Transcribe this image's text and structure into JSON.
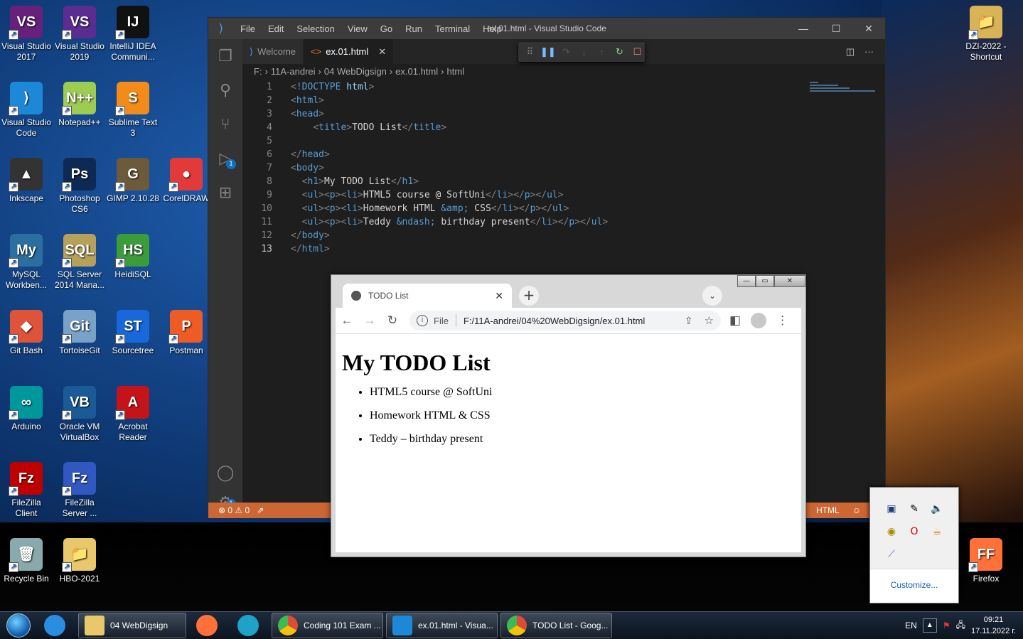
{
  "desktop": {
    "icons": [
      {
        "label": "Visual Studio 2017",
        "glyph": "VS",
        "color": "#68217a"
      },
      {
        "label": "Visual Studio 2019",
        "glyph": "VS",
        "color": "#5c2d91"
      },
      {
        "label": "IntelliJ IDEA Communi...",
        "glyph": "IJ",
        "color": "#111"
      },
      {
        "label": "Visual Studio Code",
        "glyph": "⟩",
        "color": "#1e88d8"
      },
      {
        "label": "Notepad++",
        "glyph": "N++",
        "color": "#9ccc52"
      },
      {
        "label": "Sublime Text 3",
        "glyph": "S",
        "color": "#f38b1a"
      },
      {
        "label": "Inkscape",
        "glyph": "▲",
        "color": "#333"
      },
      {
        "label": "Photoshop CS6",
        "glyph": "Ps",
        "color": "#0e2a53"
      },
      {
        "label": "GIMP 2.10.28",
        "glyph": "G",
        "color": "#6d5a3a"
      },
      {
        "label": "CorelDRAW",
        "glyph": "●",
        "color": "#e23a3a"
      },
      {
        "label": "MySQL Workben...",
        "glyph": "My",
        "color": "#2b6ea0"
      },
      {
        "label": "SQL Server 2014 Mana...",
        "glyph": "SQL",
        "color": "#b5a15a"
      },
      {
        "label": "HeidiSQL",
        "glyph": "HS",
        "color": "#3c9c3c"
      },
      {
        "label": "Git Bash",
        "glyph": "◆",
        "color": "#e0533b"
      },
      {
        "label": "TortoiseGit",
        "glyph": "Git",
        "color": "#7aa2c8"
      },
      {
        "label": "Sourcetree",
        "glyph": "ST",
        "color": "#1868db"
      },
      {
        "label": "Postman",
        "glyph": "P",
        "color": "#ef5b25"
      },
      {
        "label": "Arduino",
        "glyph": "∞",
        "color": "#00979c"
      },
      {
        "label": "Oracle VM VirtualBox",
        "glyph": "VB",
        "color": "#1a5a96"
      },
      {
        "label": "Acrobat Reader",
        "glyph": "A",
        "color": "#c4141a"
      },
      {
        "label": "FileZilla Client",
        "glyph": "Fz",
        "color": "#bf0000"
      },
      {
        "label": "FileZilla Server ...",
        "glyph": "Fz",
        "color": "#3058c0"
      },
      {
        "label": "Recycle Bin",
        "glyph": "🗑",
        "color": "#8aa"
      },
      {
        "label": "HBO-2021",
        "glyph": "📁",
        "color": "#e8c86a"
      },
      {
        "label": "DZI-2022 - Shortcut",
        "glyph": "📁",
        "color": "#d9b355"
      },
      {
        "label": "Firefox",
        "glyph": "FF",
        "color": "#ff7139"
      }
    ]
  },
  "vscode": {
    "menu": [
      "File",
      "Edit",
      "Selection",
      "View",
      "Go",
      "Run",
      "Terminal",
      "Help"
    ],
    "window_title": "ex.01.html - Visual Studio Code",
    "tabs": [
      {
        "label": "Welcome"
      },
      {
        "label": "ex.01.html"
      }
    ],
    "breadcrumb": [
      "F:",
      "11A-andrei",
      "04 WebDigsign",
      "ex.01.html",
      "html"
    ],
    "activity_badges": [
      "1",
      "1"
    ],
    "status": {
      "errors": "0",
      "warnings": "0",
      "language": "HTML"
    }
  },
  "code_lines": [
    {
      "n": "1",
      "html": "<span class='br'>&lt;</span><span class='tag'>!DOCTYPE</span> <span class='tag' style='color:#9cdcfe'>html</span><span class='br'>&gt;</span>"
    },
    {
      "n": "2",
      "html": "<span class='br'>&lt;</span><span class='tag'>html</span><span class='br'>&gt;</span>"
    },
    {
      "n": "3",
      "html": "<span class='br'>&lt;</span><span class='tag'>head</span><span class='br'>&gt;</span>"
    },
    {
      "n": "4",
      "html": "    <span class='br'>&lt;</span><span class='tag'>title</span><span class='br'>&gt;</span>TODO List<span class='br'>&lt;/</span><span class='tag'>title</span><span class='br'>&gt;</span>"
    },
    {
      "n": "5",
      "html": ""
    },
    {
      "n": "6",
      "html": "<span class='br'>&lt;/</span><span class='tag'>head</span><span class='br'>&gt;</span>"
    },
    {
      "n": "7",
      "html": "<span class='br'>&lt;</span><span class='tag'>body</span><span class='br'>&gt;</span>"
    },
    {
      "n": "8",
      "html": "  <span class='br'>&lt;</span><span class='tag'>h1</span><span class='br'>&gt;</span>My TODO List<span class='br'>&lt;/</span><span class='tag'>h1</span><span class='br'>&gt;</span>"
    },
    {
      "n": "9",
      "html": "  <span class='br'>&lt;</span><span class='tag'>ul</span><span class='br'>&gt;&lt;</span><span class='tag'>p</span><span class='br'>&gt;&lt;</span><span class='tag'>li</span><span class='br'>&gt;</span>HTML5 course @ SoftUni<span class='br'>&lt;/</span><span class='tag'>li</span><span class='br'>&gt;&lt;/</span><span class='tag'>p</span><span class='br'>&gt;&lt;/</span><span class='tag'>ul</span><span class='br'>&gt;</span>"
    },
    {
      "n": "10",
      "html": "  <span class='br'>&lt;</span><span class='tag'>ul</span><span class='br'>&gt;&lt;</span><span class='tag'>p</span><span class='br'>&gt;&lt;</span><span class='tag'>li</span><span class='br'>&gt;</span>Homework HTML <span class='ent'>&amp;amp;</span> CSS<span class='br'>&lt;/</span><span class='tag'>li</span><span class='br'>&gt;&lt;/</span><span class='tag'>p</span><span class='br'>&gt;&lt;/</span><span class='tag'>ul</span><span class='br'>&gt;</span>"
    },
    {
      "n": "11",
      "html": "  <span class='br'>&lt;</span><span class='tag'>ul</span><span class='br'>&gt;&lt;</span><span class='tag'>p</span><span class='br'>&gt;&lt;</span><span class='tag'>li</span><span class='br'>&gt;</span>Teddy <span class='ent'>&amp;ndash;</span> birthday present<span class='br'>&lt;/</span><span class='tag'>li</span><span class='br'>&gt;&lt;/</span><span class='tag'>p</span><span class='br'>&gt;&lt;/</span><span class='tag'>ul</span><span class='br'>&gt;</span>"
    },
    {
      "n": "12",
      "html": "<span class='br'>&lt;/</span><span class='tag'>body</span><span class='br'>&gt;</span>"
    },
    {
      "n": "13",
      "html": "<span class='br'>&lt;/</span><span class='tag'>html</span><span class='br'>&gt;</span>"
    }
  ],
  "chrome": {
    "tab_title": "TODO List",
    "scheme_label": "File",
    "url": "F:/11A-andrei/04%20WebDigsign/ex.01.html",
    "page": {
      "heading": "My TODO List",
      "items": [
        "HTML5 course @ SoftUni",
        "Homework HTML & CSS",
        "Teddy – birthday present"
      ]
    }
  },
  "tray_popup": {
    "customize": "Customize..."
  },
  "taskbar": {
    "items": [
      {
        "label": "04 WebDigsign",
        "color": "#e8c86a"
      },
      {
        "label": "Coding 101 Exam ...",
        "color": "#dd4b39"
      },
      {
        "label": "ex.01.html - Visua...",
        "color": "#1e88d8"
      },
      {
        "label": "TODO List - Goog...",
        "color": "#dd4b39"
      }
    ],
    "lang": "EN",
    "time": "09:21",
    "date": "17.11.2022 г."
  }
}
